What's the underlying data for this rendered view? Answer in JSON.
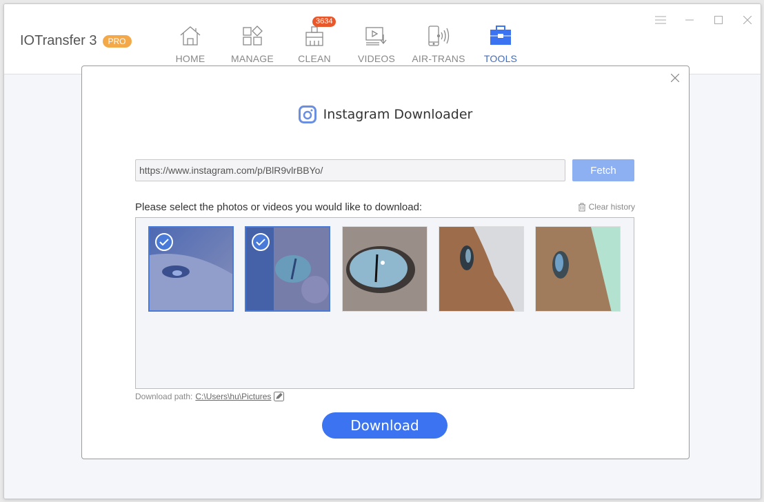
{
  "app": {
    "title": "IOTransfer 3",
    "badge": "PRO"
  },
  "nav": {
    "items": [
      {
        "label": "HOME",
        "icon": "home-icon"
      },
      {
        "label": "MANAGE",
        "icon": "manage-icon"
      },
      {
        "label": "CLEAN",
        "icon": "broom-icon",
        "badge": "3634"
      },
      {
        "label": "VIDEOS",
        "icon": "video-download-icon"
      },
      {
        "label": "AIR-TRANS",
        "icon": "phone-wireless-icon"
      },
      {
        "label": "TOOLS",
        "icon": "toolbox-icon",
        "active": true
      }
    ]
  },
  "window_controls": [
    "menu-icon",
    "minimize-icon",
    "maximize-icon",
    "close-icon"
  ],
  "modal": {
    "title": "Instagram Downloader",
    "url_value": "https://www.instagram.com/p/BlR9vlrBBYo/",
    "fetch_label": "Fetch",
    "select_label": "Please select the photos or videos you would like to download:",
    "clear_history_label": "Clear history",
    "thumbnails": [
      {
        "subject": "cat-eye-profile-1",
        "selected": true
      },
      {
        "subject": "cat-eye-green",
        "selected": true
      },
      {
        "subject": "cat-eye-blue-closeup",
        "selected": false
      },
      {
        "subject": "cat-profile-orange",
        "selected": false
      },
      {
        "subject": "cat-profile-green-bg",
        "selected": false
      }
    ],
    "download_path_label": "Download path:",
    "download_path_value": "C:\\Users\\hu\\Pictures",
    "download_label": "Download"
  },
  "colors": {
    "accent": "#3b73f0",
    "fetch_disabled": "#8db0f3",
    "badge_orange": "#e9582a",
    "pro_badge": "#f3a94a",
    "active_nav": "#3f6bc0"
  }
}
